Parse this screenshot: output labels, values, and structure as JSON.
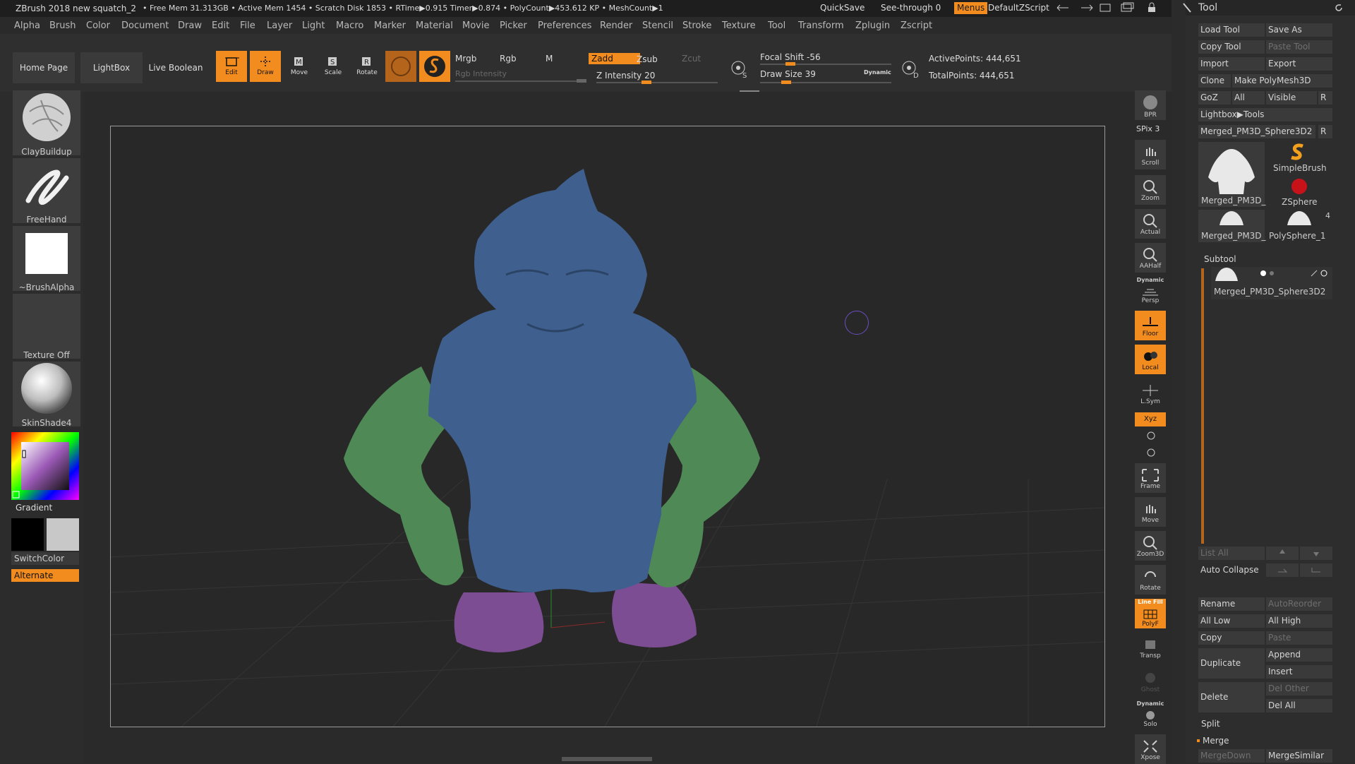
{
  "titlebar": {
    "doc_title": "ZBrush 2018 new squatch_2",
    "stats": "• Free Mem 31.313GB • Active Mem 1454 • Scratch Disk 1853 •  RTime▶0.915 Timer▶0.874 • PolyCount▶453.612 KP  • MeshCount▶1",
    "quicksave": "QuickSave",
    "see_through": "See-through  0",
    "menus": "Menus",
    "script": "DefaultZScript"
  },
  "menubar": [
    "Alpha",
    "Brush",
    "Color",
    "Document",
    "Draw",
    "Edit",
    "File",
    "Layer",
    "Light",
    "Macro",
    "Marker",
    "Material",
    "Movie",
    "Picker",
    "Preferences",
    "Render",
    "Stencil",
    "Stroke",
    "Texture",
    "Tool",
    "Transform",
    "Zplugin",
    "Zscript"
  ],
  "shelf": {
    "home_page": "Home Page",
    "lightbox": "LightBox",
    "live_boolean": "Live Boolean",
    "edit": "Edit",
    "draw": "Draw",
    "move": "Move",
    "scale": "Scale",
    "rotate": "Rotate",
    "mrgb": "Mrgb",
    "rgb": "Rgb",
    "m": "M",
    "rgb_intensity": "Rgb Intensity",
    "zadd": "Zadd",
    "zsub": "Zsub",
    "zcut": "Zcut",
    "z_intensity": "Z Intensity 20",
    "focal_shift": "Focal Shift -56",
    "draw_size": "Draw Size 39",
    "dynamic": "Dynamic",
    "active_points": "ActivePoints: 444,651",
    "total_points": "TotalPoints: 444,651",
    "z_intensity_value": 20,
    "focal_shift_value": -56,
    "draw_size_value": 39
  },
  "left": {
    "brush": "ClayBuildup",
    "stroke": "FreeHand",
    "alpha": "~BrushAlpha",
    "texture": "Texture Off",
    "material": "SkinShade4",
    "gradient": "Gradient",
    "switchcolor": "SwitchColor",
    "alternate": "Alternate"
  },
  "dock": [
    "BPR",
    "SPix 3",
    "Scroll",
    "Zoom",
    "Actual",
    "AAHalf",
    "Dynamic",
    "Persp",
    "Floor",
    "Local",
    "L.Sym",
    "Xyz",
    "Frame",
    "Move",
    "Zoom3D",
    "Rotate",
    "Line Fill",
    "PolyF",
    "Transp",
    "Ghost",
    "Dynamic",
    "Solo",
    "Xpose"
  ],
  "tool": {
    "title": "Tool",
    "load_tool": "Load Tool",
    "save_as": "Save As",
    "copy_tool": "Copy Tool",
    "paste_tool": "Paste Tool",
    "import": "Import",
    "export": "Export",
    "clone": "Clone",
    "make_polymesh": "Make PolyMesh3D",
    "goz": "GoZ",
    "all": "All",
    "visible": "Visible",
    "r": "R",
    "lightbox_tools": "Lightbox▶Tools",
    "current_tool": "Merged_PM3D_Sphere3D2",
    "thumbs": [
      "Merged_PM3D_",
      "SimpleBrush",
      "ZSphere",
      "Merged_PM3D_",
      "PolySphere_1"
    ],
    "count": "4",
    "subtool": "Subtool",
    "subtool_item": "Merged_PM3D_Sphere3D2",
    "list_all": "List All",
    "auto_collapse": "Auto Collapse",
    "rename": "Rename",
    "autoreorder": "AutoReorder",
    "all_low": "All Low",
    "all_high": "All High",
    "copy": "Copy",
    "paste": "Paste",
    "duplicate": "Duplicate",
    "append": "Append",
    "insert": "Insert",
    "delete": "Delete",
    "del_other": "Del Other",
    "del_all": "Del All",
    "split": "Split",
    "merge": "Merge",
    "mergedown": "MergeDown",
    "mergesimilar": "MergeSimilar"
  },
  "colors": {
    "accent": "#f28c1e",
    "bg": "#2b2b2b",
    "body": "#3f5f8e",
    "arms": "#4f8a56",
    "feet": "#7d4d94"
  }
}
